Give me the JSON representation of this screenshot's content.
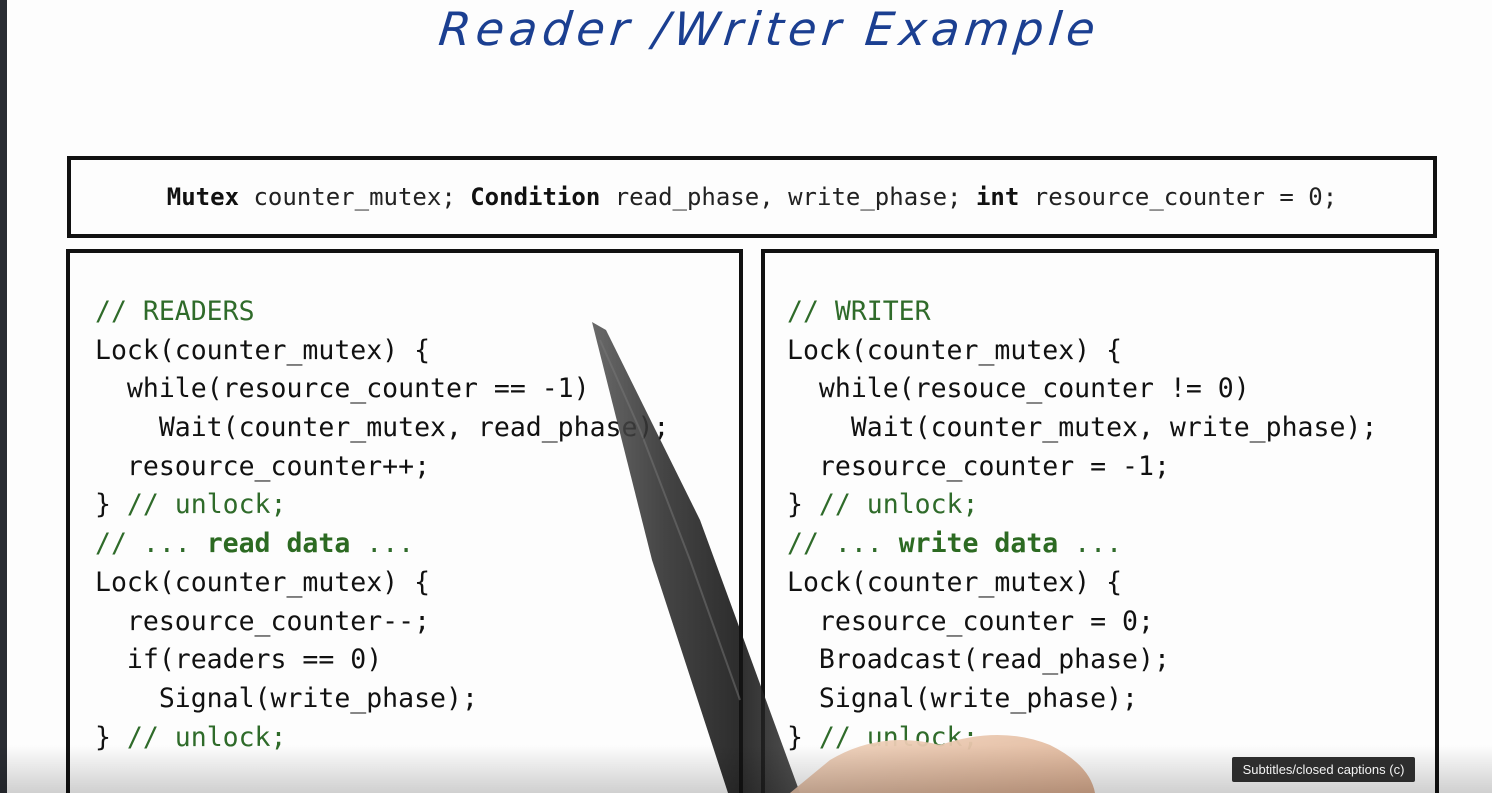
{
  "slide": {
    "title": "Reader /Writer Example",
    "declaration": {
      "mutex_kw": "Mutex",
      "mutex_rest": " counter_mutex; ",
      "cond_kw": "Condition",
      "cond_rest": " read_phase, write_phase; ",
      "int_kw": "int",
      "int_rest": " resource_counter = 0;"
    },
    "readers": {
      "heading": "// READERS",
      "lines": [
        "Lock(counter_mutex) {",
        "  while(resource_counter == -1)",
        "    Wait(counter_mutex, read_phase);",
        "  resource_counter++;"
      ],
      "unlock_brace": "} ",
      "unlock_comment": "// unlock;",
      "read_prefix": "// ... ",
      "read_bold": "read data",
      "read_suffix": " ...",
      "lines2": [
        "Lock(counter_mutex) {",
        "  resource_counter--;",
        "  if(readers == 0)",
        "    Signal(write_phase);"
      ],
      "unlock2_brace": "} ",
      "unlock2_comment": "// unlock;"
    },
    "writer": {
      "heading": "// WRITER",
      "lines": [
        "Lock(counter_mutex) {",
        "  while(resouce_counter != 0)",
        "    Wait(counter_mutex, write_phase);",
        "  resource_counter = -1;"
      ],
      "unlock_brace": "} ",
      "unlock_comment": "// unlock;",
      "write_prefix": "// ... ",
      "write_bold": "write data",
      "write_suffix": " ...",
      "lines2": [
        "Lock(counter_mutex) {",
        "  resource_counter = 0;",
        "  Broadcast(read_phase);",
        "  Signal(write_phase);"
      ],
      "unlock2_brace": "} ",
      "unlock2_comment": "// unlock;"
    }
  },
  "player": {
    "captions_button_label": "Subtitles/closed captions (c)"
  },
  "colors": {
    "title_ink": "#1b3f91",
    "comment_green": "#2f6b2a",
    "border": "#111111"
  }
}
